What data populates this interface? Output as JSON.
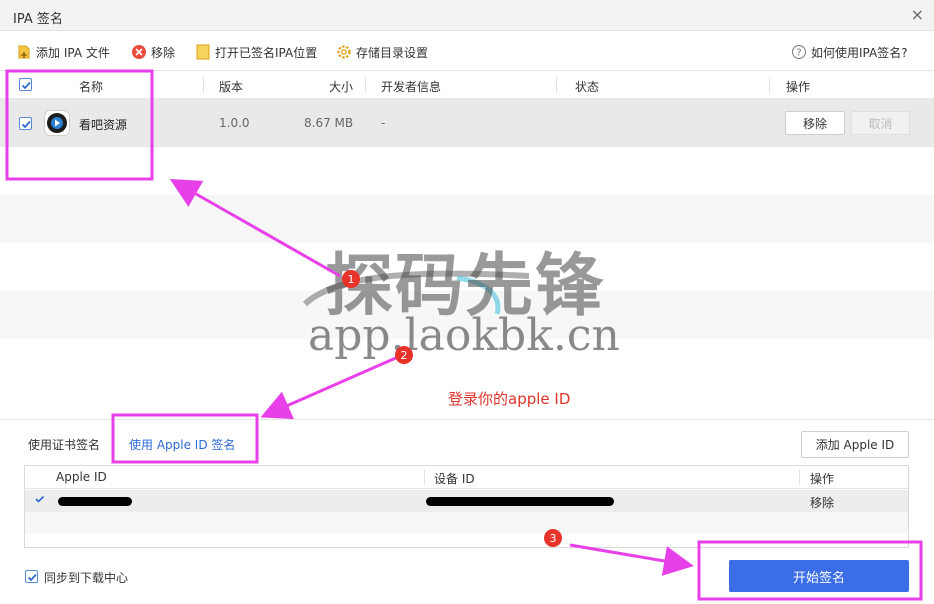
{
  "window": {
    "title": "IPA 签名",
    "close_glyph": "×"
  },
  "toolbar": {
    "add_ipa": "添加 IPA 文件",
    "remove": "移除",
    "open_signed": "打开已签名IPA位置",
    "storage_settings": "存储目录设置",
    "help": "如何使用IPA签名?"
  },
  "table": {
    "headers": {
      "name": "名称",
      "version": "版本",
      "size": "大小",
      "developer": "开发者信息",
      "status": "状态",
      "action": "操作"
    },
    "rows": [
      {
        "checked": true,
        "name": "看吧资源",
        "version": "1.0.0",
        "size": "8.67 MB",
        "developer": "-",
        "remove_label": "移除",
        "cancel_label": "取消"
      }
    ]
  },
  "watermark": {
    "brand": "探码先锋",
    "url": "app.laokbk.cn"
  },
  "instruction": "登录你的apple ID",
  "sign_tabs": {
    "cert": "使用证书签名",
    "apple_id": "使用 Apple ID 签名"
  },
  "add_apple_id": "添加 Apple ID",
  "apple_table": {
    "headers": {
      "apple_id": "Apple ID",
      "device_id": "设备 ID",
      "action": "操作"
    },
    "rows": [
      {
        "remove_label": "移除"
      }
    ]
  },
  "sync": {
    "checked": true,
    "label": "同步到下载中心"
  },
  "start_button": "开始签名",
  "annotations": {
    "steps": [
      "1",
      "2",
      "3"
    ]
  },
  "colors": {
    "accent": "#3a6de6",
    "highlight": "#e840e8",
    "step_badge": "#e8332a",
    "instruction": "#e0352b"
  }
}
